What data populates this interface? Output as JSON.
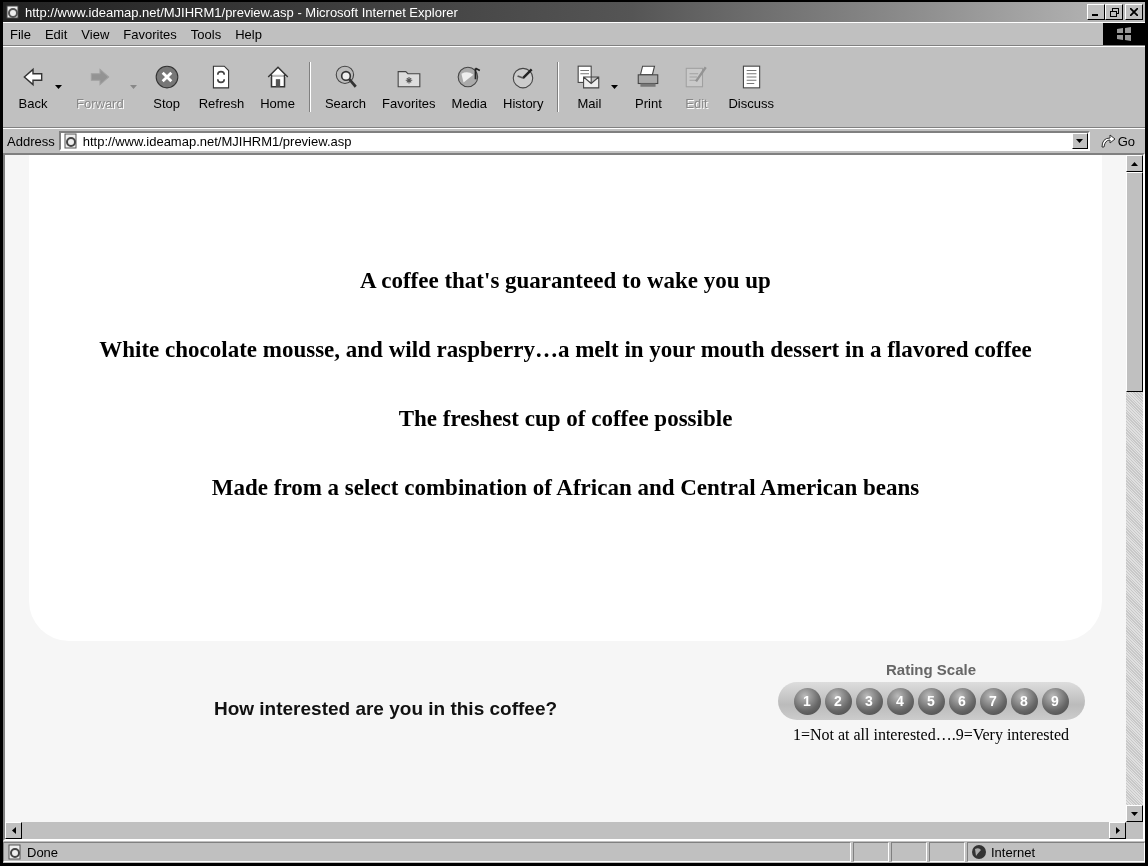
{
  "window": {
    "title": "http://www.ideamap.net/MJIHRM1/preview.asp - Microsoft Internet Explorer"
  },
  "menu": [
    "File",
    "Edit",
    "View",
    "Favorites",
    "Tools",
    "Help"
  ],
  "toolbar": {
    "groups": [
      [
        {
          "label": "Back",
          "disabled": false,
          "dropdown": true
        },
        {
          "label": "Forward",
          "disabled": true,
          "dropdown": true
        },
        {
          "label": "Stop",
          "disabled": false,
          "dropdown": false
        },
        {
          "label": "Refresh",
          "disabled": false,
          "dropdown": false
        },
        {
          "label": "Home",
          "disabled": false,
          "dropdown": false
        }
      ],
      [
        {
          "label": "Search",
          "disabled": false,
          "dropdown": false
        },
        {
          "label": "Favorites",
          "disabled": false,
          "dropdown": false
        },
        {
          "label": "Media",
          "disabled": false,
          "dropdown": false
        },
        {
          "label": "History",
          "disabled": false,
          "dropdown": false
        }
      ],
      [
        {
          "label": "Mail",
          "disabled": false,
          "dropdown": true
        },
        {
          "label": "Print",
          "disabled": false,
          "dropdown": false
        },
        {
          "label": "Edit",
          "disabled": true,
          "dropdown": false
        },
        {
          "label": "Discuss",
          "disabled": false,
          "dropdown": false
        }
      ]
    ]
  },
  "address": {
    "label": "Address",
    "value": "http://www.ideamap.net/MJIHRM1/preview.asp",
    "go": "Go"
  },
  "page": {
    "statements": [
      "A coffee that's guaranteed to wake you up",
      "White chocolate mousse, and wild raspberry…a melt in your mouth dessert in a flavored coffee",
      "The freshest cup of coffee possible",
      "Made from a select combination of African and Central American beans"
    ],
    "question": "How interested are you in this coffee?",
    "rating": {
      "title": "Rating Scale",
      "options": [
        {
          "label": "1",
          "selected": false
        },
        {
          "label": "2",
          "selected": false
        },
        {
          "label": "3",
          "selected": false
        },
        {
          "label": "4",
          "selected": false
        },
        {
          "label": "5",
          "selected": false
        },
        {
          "label": "6",
          "selected": false
        },
        {
          "label": "7",
          "selected": false
        },
        {
          "label": "8",
          "selected": false
        },
        {
          "label": "9",
          "selected": false
        }
      ],
      "legend": "1=Not at all interested….9=Very interested"
    }
  },
  "status_bar": {
    "text": "Done",
    "zone": "Internet"
  }
}
